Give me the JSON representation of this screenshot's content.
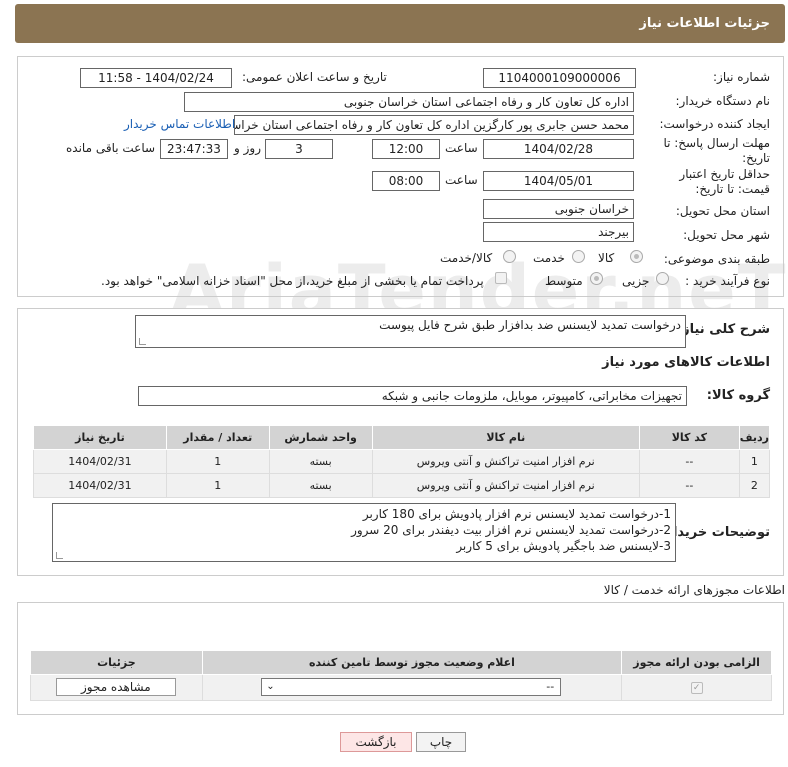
{
  "header": {
    "title": "جزئیات اطلاعات نیاز"
  },
  "watermark": "AriaTender.neT",
  "form": {
    "need_number_label": "شماره نیاز:",
    "need_number": "1104000109000006",
    "announce_label": "تاریخ و ساعت اعلان عمومی:",
    "announce_value": "1404/02/24 - 11:58",
    "buyer_org_label": "نام دستگاه خریدار:",
    "buyer_org": "اداره کل تعاون کار و رفاه اجتماعی استان خراسان جنوبی",
    "requester_label": "ایجاد کننده درخواست:",
    "requester": "محمد حسن جابری پور کارگزین اداره کل تعاون کار و رفاه اجتماعی استان خراسان جنوبی",
    "contact_link": "اطلاعات تماس خریدار",
    "reply_deadline_label": "مهلت ارسال پاسخ: تا تاریخ:",
    "reply_date": "1404/02/28",
    "time_label": "ساعت",
    "reply_time": "12:00",
    "days": "3",
    "days_label": "روز و",
    "remaining": "23:47:33",
    "remaining_label": "ساعت باقی مانده",
    "price_validity_label": "حداقل تاریخ اعتبار قیمت: تا تاریخ:",
    "price_date": "1404/05/01",
    "price_time": "08:00",
    "province_label": "استان محل تحویل:",
    "province": "خراسان جنوبی",
    "city_label": "شهر محل تحویل:",
    "city": "بیرجند",
    "category_label": "طبقه بندی موضوعی:",
    "category_options": [
      "کالا",
      "خدمت",
      "کالا/خدمت"
    ],
    "process_label": "نوع فرآیند خرید :",
    "process_options": [
      "جزیی",
      "متوسط"
    ],
    "payment_note": "پرداخت تمام یا بخشی از مبلغ خرید،از محل \"اسناد خزانه اسلامی\" خواهد بود."
  },
  "description": {
    "label": "شرح کلی نیاز:",
    "text": "درخواست تمدید لایسنس ضد بدافزار طبق شرح فایل پیوست"
  },
  "goods": {
    "section_title": "اطلاعات کالاهای مورد نیاز",
    "group_label": "گروه کالا:",
    "group_value": "تجهیزات مخابراتی، کامپیوتر، موبایل، ملزومات جانبی و شبکه",
    "columns": [
      "ردیف",
      "کد کالا",
      "نام کالا",
      "واحد شمارش",
      "تعداد / مقدار",
      "تاریخ نیاز"
    ],
    "rows": [
      [
        "1",
        "--",
        "نرم افزار امنیت تراکنش و آنتی ویروس",
        "بسته",
        "1",
        "1404/02/31"
      ],
      [
        "2",
        "--",
        "نرم افزار امنیت تراکنش و آنتی ویروس",
        "بسته",
        "1",
        "1404/02/31"
      ]
    ],
    "buyer_notes_label": "توضیحات خریدار:",
    "buyer_notes": [
      "1-درخواست تمدید لایسنس نرم افزار پادویش برای 180 کاربر",
      "2-درخواست تمدید لایسنس نرم افزار بیت دیفندر برای 20 سرور",
      "3-لایسنس ضد باجگیر پادویش برای 5 کاربر"
    ]
  },
  "permits": {
    "section_title": "اطلاعات مجوزهای ارائه خدمت / کالا",
    "columns": [
      "الزامی بودن ارائه مجوز",
      "اعلام وضعیت مجوز توسط تامین کننده",
      "جزئیات"
    ],
    "select_value": "--",
    "view_button": "مشاهده مجوز"
  },
  "footer": {
    "print_button": "چاپ",
    "back_button": "بازگشت"
  }
}
